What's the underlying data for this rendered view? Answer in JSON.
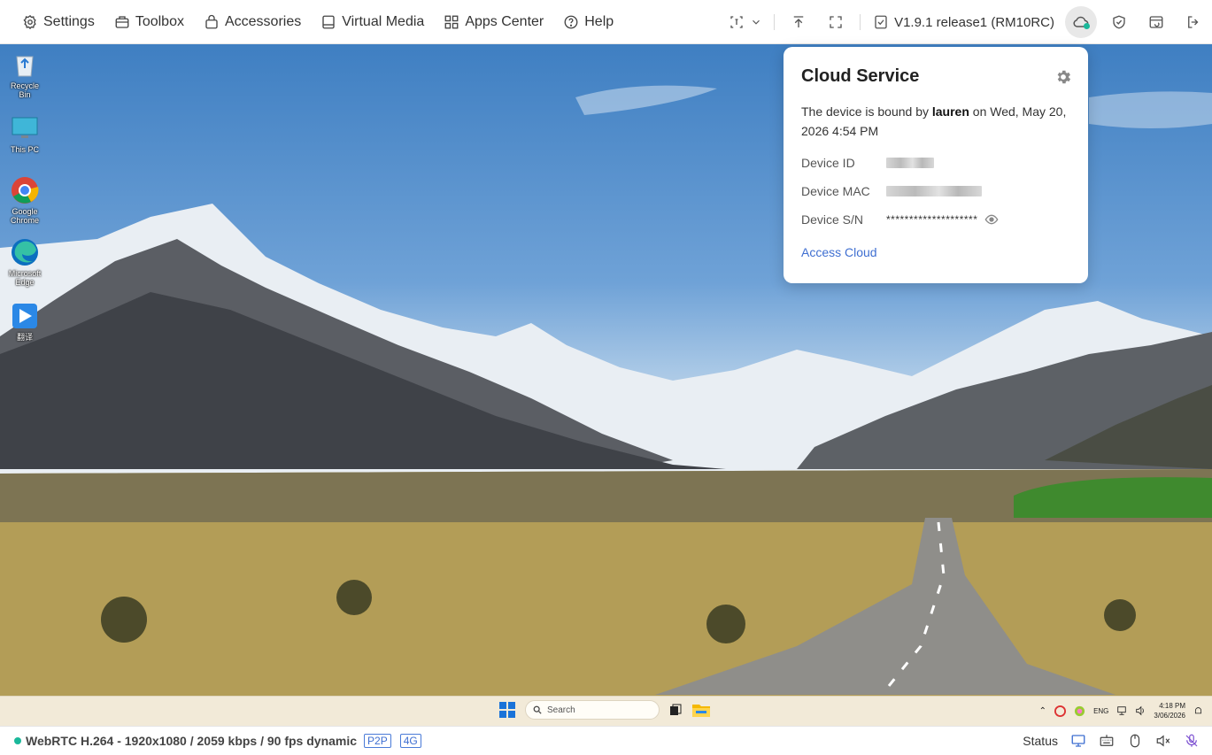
{
  "toolbar": {
    "menu": [
      {
        "label": "Settings",
        "icon": "gear-icon"
      },
      {
        "label": "Toolbox",
        "icon": "toolbox-icon"
      },
      {
        "label": "Accessories",
        "icon": "bag-icon"
      },
      {
        "label": "Virtual Media",
        "icon": "drive-icon"
      },
      {
        "label": "Apps Center",
        "icon": "apps-icon"
      },
      {
        "label": "Help",
        "icon": "help-icon"
      }
    ],
    "version": "V1.9.1 release1 (RM10RC)"
  },
  "desktop": {
    "icons": [
      {
        "label": "Recycle Bin"
      },
      {
        "label": "This PC"
      },
      {
        "label": "Google Chrome"
      },
      {
        "label": "Microsoft Edge"
      },
      {
        "label": "翻译"
      }
    ],
    "taskbar": {
      "search_placeholder": "Search",
      "lang": "ENG",
      "time": "4:18 PM",
      "date": "3/06/2026"
    }
  },
  "cloud_popup": {
    "title": "Cloud Service",
    "bound_prefix": "The device is bound by ",
    "bound_user": "lauren",
    "bound_suffix": " on Wed, May 20, 2026 4:54 PM",
    "device_id_label": "Device ID",
    "device_mac_label": "Device MAC",
    "device_sn_label": "Device S/N",
    "device_sn_value": "********************",
    "access_link": "Access Cloud"
  },
  "statusbar": {
    "stream": "WebRTC H.264 - 1920x1080 /  2059 kbps / 90 fps dynamic",
    "tag_p2p": "P2P",
    "tag_net": "4G",
    "status_label": "Status"
  },
  "colors": {
    "accent": "#3f6fd1",
    "online": "#1ab89a"
  }
}
